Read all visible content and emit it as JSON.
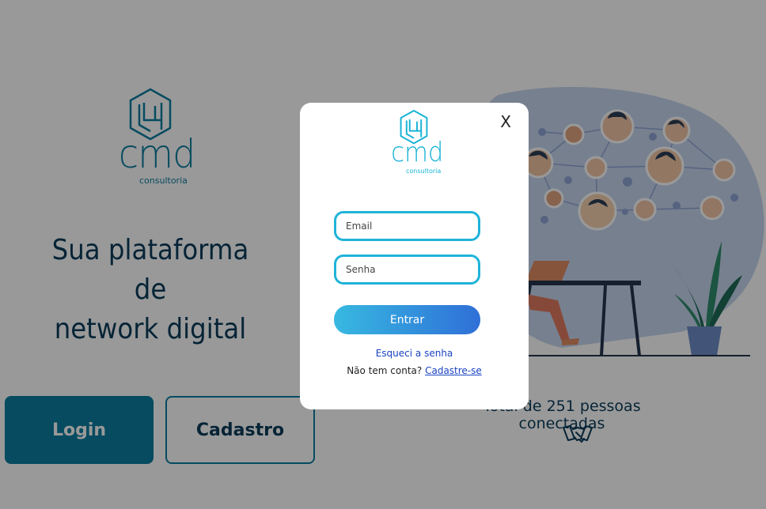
{
  "brand": {
    "name": "cmd",
    "sub": "consultoria"
  },
  "hero": {
    "tagline_line1": "Sua plataforma de",
    "tagline_line2": "network digital"
  },
  "buttons": {
    "login": "Login",
    "cadastro": "Cadastro"
  },
  "counter": {
    "text": "Total de 251 pessoas conectadas"
  },
  "modal": {
    "close_label": "X",
    "email_placeholder": "Email",
    "password_placeholder": "Senha",
    "submit_label": "Entrar",
    "forgot_label": "Esqueci a senha",
    "signup_prompt": "Não tem conta?",
    "signup_link": "Cadastre-se"
  },
  "colors": {
    "brand_dark": "#0b7ea1",
    "brand_light": "#19b3d6",
    "text_dark": "#0b3c5a",
    "overlay": "rgba(0,0,0,0.40)",
    "button_gradient_start": "#37b9e0",
    "button_gradient_end": "#2f6fd8",
    "link": "#1a44c2"
  },
  "icons": {
    "brand_mark": "cmd-logo-mark",
    "counter": "handshake-icon",
    "close": "close-icon"
  }
}
